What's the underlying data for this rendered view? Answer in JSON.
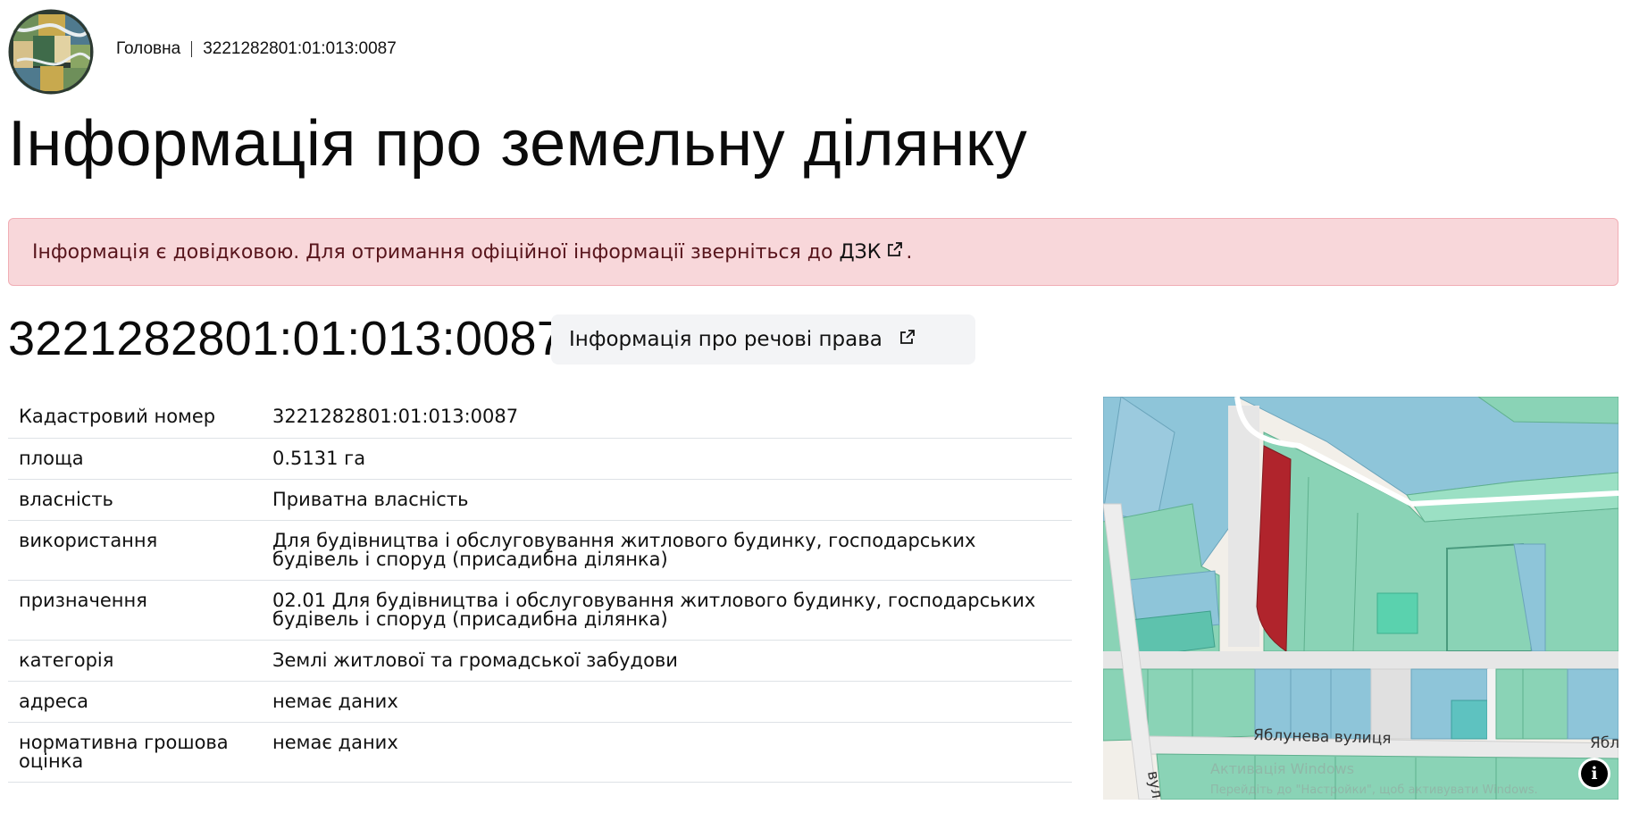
{
  "breadcrumb": {
    "home": "Головна",
    "current": "3221282801:01:013:0087"
  },
  "page_title": "Інформація про земельну ділянку",
  "alert": {
    "text": "Інформація є довідковою. Для отримання офіційної інформації зверніться до",
    "link": "ДЗК",
    "end": "."
  },
  "parcel": {
    "cadastral_title": "3221282801:01:013:0087",
    "rights_button": "Інформація про речові права"
  },
  "table": {
    "rows": [
      {
        "key": "Кадастровий номер",
        "value": "3221282801:01:013:0087"
      },
      {
        "key": "площа",
        "value": "0.5131 га"
      },
      {
        "key": "власність",
        "value": "Приватна власність"
      },
      {
        "key": "використання",
        "value": "Для будівництва і обслуговування житлового будинку, господарських будівель і споруд (присадибна ділянка)"
      },
      {
        "key": "призначення",
        "value": "02.01 Для будівництва і обслуговування житлового будинку, господарських будівель і споруд (присадибна ділянка)"
      },
      {
        "key": "категорія",
        "value": "Землі житлової та громадської забудови"
      },
      {
        "key": "адреса",
        "value": "немає даних"
      },
      {
        "key": "нормативна грошова оцінка",
        "value": "немає даних"
      }
    ]
  },
  "map": {
    "street_label": "Яблунева вулиця",
    "street_label_right": "Ябл",
    "street_label_vertical": "вул",
    "attribution_icon": "info-icon",
    "watermark_title": "Активація Windows",
    "watermark_sub": "Перейдіть до \"Настройки\", щоб активувати Windows.",
    "colors": {
      "parcel_selected": "#b0242c",
      "residential": "#8ad3b6",
      "other": "#8ec5d9",
      "road": "#e6e6e6"
    }
  },
  "icons": {
    "external": "external-link-icon",
    "logo": "site-logo"
  }
}
